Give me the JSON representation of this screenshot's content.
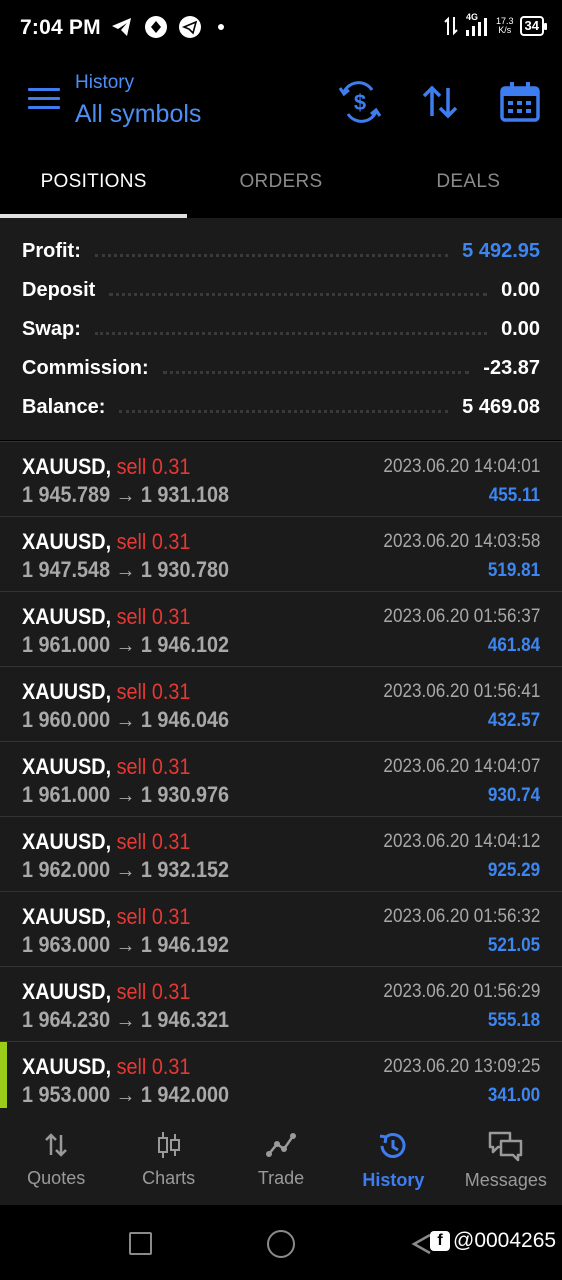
{
  "status_bar": {
    "time": "7:04 PM",
    "net_label": "4G",
    "speed_value": "17.3",
    "speed_unit": "K/s",
    "battery": "34"
  },
  "header": {
    "subtitle": "History",
    "title": "All symbols"
  },
  "tabs": [
    {
      "label": "POSITIONS",
      "active": true
    },
    {
      "label": "ORDERS",
      "active": false
    },
    {
      "label": "DEALS",
      "active": false
    }
  ],
  "summary": [
    {
      "label": "Profit:",
      "value": "5 492.95"
    },
    {
      "label": "Deposit",
      "value": "0.00"
    },
    {
      "label": "Swap:",
      "value": "0.00"
    },
    {
      "label": "Commission:",
      "value": "-23.87"
    },
    {
      "label": "Balance:",
      "value": "5 469.08"
    }
  ],
  "positions": [
    {
      "symbol": "XAUUSD,",
      "side": "sell 0.31",
      "open": "1 945.789",
      "close": "1 931.108",
      "datetime": "2023.06.20 14:04:01",
      "profit": "455.11"
    },
    {
      "symbol": "XAUUSD,",
      "side": "sell 0.31",
      "open": "1 947.548",
      "close": "1 930.780",
      "datetime": "2023.06.20 14:03:58",
      "profit": "519.81"
    },
    {
      "symbol": "XAUUSD,",
      "side": "sell 0.31",
      "open": "1 961.000",
      "close": "1 946.102",
      "datetime": "2023.06.20 01:56:37",
      "profit": "461.84"
    },
    {
      "symbol": "XAUUSD,",
      "side": "sell 0.31",
      "open": "1 960.000",
      "close": "1 946.046",
      "datetime": "2023.06.20 01:56:41",
      "profit": "432.57"
    },
    {
      "symbol": "XAUUSD,",
      "side": "sell 0.31",
      "open": "1 961.000",
      "close": "1 930.976",
      "datetime": "2023.06.20 14:04:07",
      "profit": "930.74"
    },
    {
      "symbol": "XAUUSD,",
      "side": "sell 0.31",
      "open": "1 962.000",
      "close": "1 932.152",
      "datetime": "2023.06.20 14:04:12",
      "profit": "925.29"
    },
    {
      "symbol": "XAUUSD,",
      "side": "sell 0.31",
      "open": "1 963.000",
      "close": "1 946.192",
      "datetime": "2023.06.20 01:56:32",
      "profit": "521.05"
    },
    {
      "symbol": "XAUUSD,",
      "side": "sell 0.31",
      "open": "1 964.230",
      "close": "1 946.321",
      "datetime": "2023.06.20 01:56:29",
      "profit": "555.18"
    },
    {
      "symbol": "XAUUSD,",
      "side": "sell 0.31",
      "open": "1 953.000",
      "close": "1 942.000",
      "datetime": "2023.06.20 13:09:25",
      "profit": "341.00"
    }
  ],
  "arrow_glyph": "→",
  "bottom_nav": [
    {
      "label": "Quotes",
      "icon": "arrows-updown-icon",
      "active": false
    },
    {
      "label": "Charts",
      "icon": "candlestick-icon",
      "active": false
    },
    {
      "label": "Trade",
      "icon": "trade-line-icon",
      "active": false
    },
    {
      "label": "History",
      "icon": "history-clock-icon",
      "active": true
    },
    {
      "label": "Messages",
      "icon": "chat-bubbles-icon",
      "active": false
    }
  ],
  "watermark": "@0004265",
  "colors": {
    "accent": "#3d7df0",
    "profit": "#3d86f0",
    "sell": "#e53935",
    "marker": "#9ccc1a"
  }
}
